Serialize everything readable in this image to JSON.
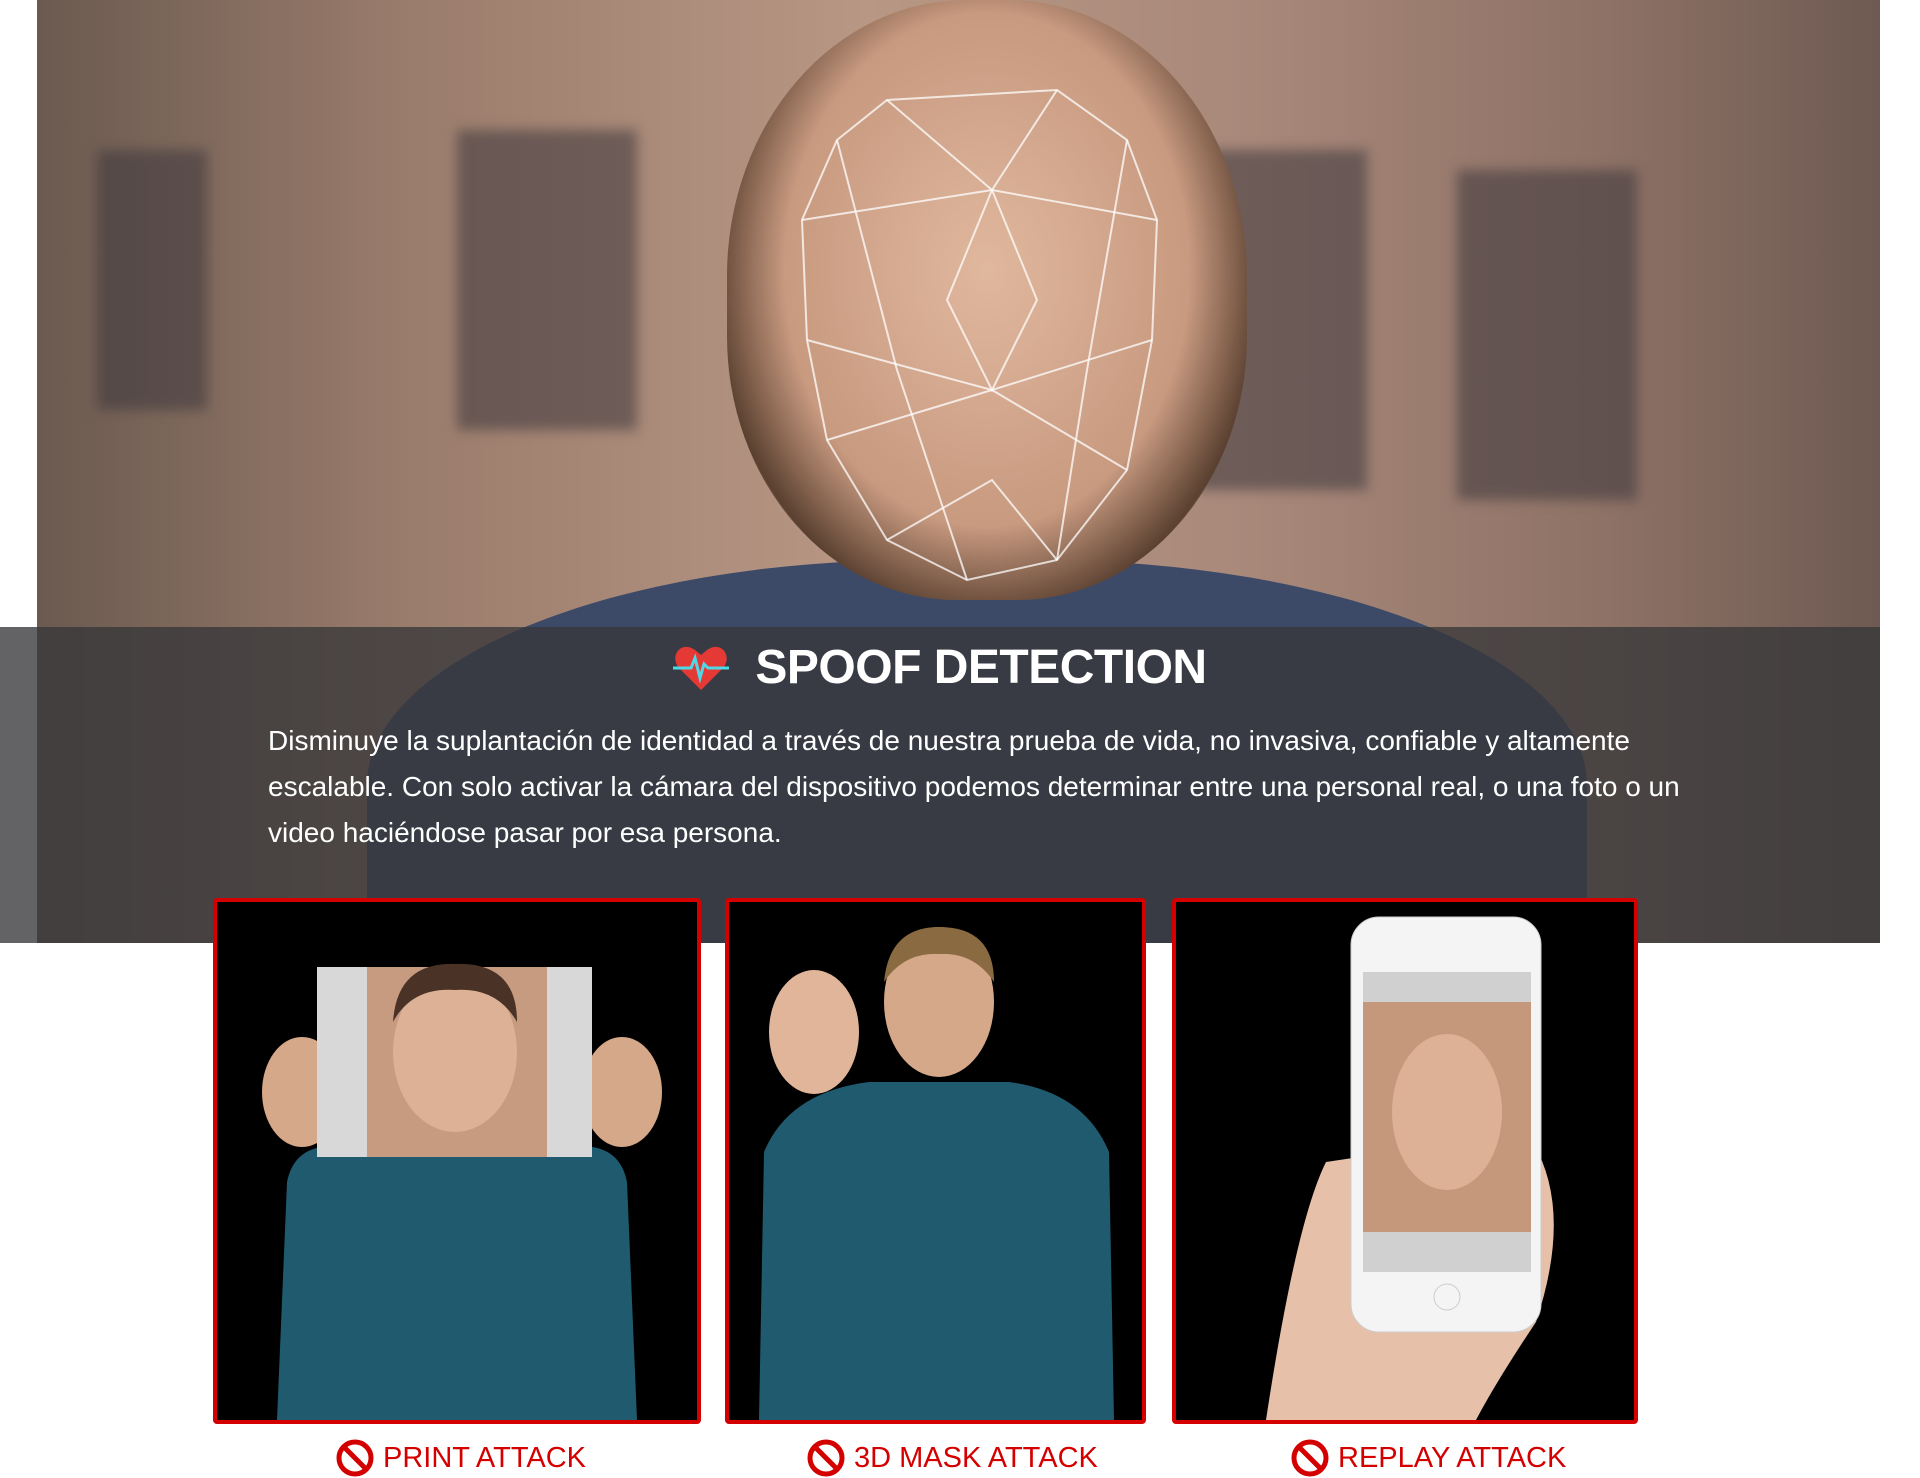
{
  "section": {
    "title": "SPOOF DETECTION",
    "title_icon": "heart-pulse-icon",
    "description": "Disminuye la suplantación de identidad a través de nuestra prueba de vida, no invasiva, confiable y altamente escalable. Con solo activar la cámara del dispositivo podemos determinar entre una personal real, o una foto o un video haciéndose pasar por esa persona."
  },
  "attacks": [
    {
      "label": "PRINT ATTACK",
      "icon": "prohibited-icon"
    },
    {
      "label": "3D MASK ATTACK",
      "icon": "prohibited-icon"
    },
    {
      "label": "REPLAY ATTACK",
      "icon": "prohibited-icon"
    }
  ],
  "colors": {
    "accent": "#d40000",
    "band": "#37373a"
  }
}
